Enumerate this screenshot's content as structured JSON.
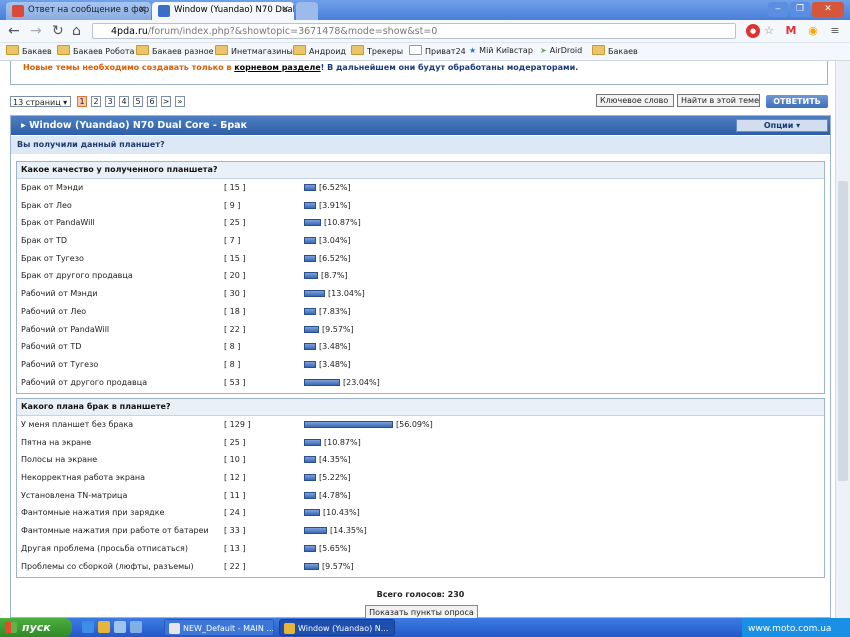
{
  "browser": {
    "tabs": [
      {
        "label": "Ответ на сообщение в фор"
      },
      {
        "label": "Window (Yuandao) N70 Dual"
      }
    ],
    "url_host": "4pda.ru",
    "url_rest": "/forum/index.php?&showtopic=3671478&mode=show&st=0",
    "bookmarks": [
      "Бакаев",
      "Бакаев Робота",
      "Бакаев разное",
      "Инетмагазины",
      "Андроид",
      "Трекеры",
      "Приват24",
      "Мій Київстар",
      "AirDroid",
      "Бакаев"
    ]
  },
  "notice": {
    "part1": "Новые темы необходимо создавать только в",
    "link": "корневом разделе",
    "part2": "! В дальнейшем они будут обработаны модераторами."
  },
  "pager": {
    "select": "13 страниц",
    "pages": [
      "1",
      "2",
      "3",
      "4",
      "5",
      "6",
      ">",
      "»"
    ],
    "current": "1"
  },
  "top_buttons": {
    "keyword": "Ключевое слово",
    "find_in_topic": "Найти в этой теме",
    "reply": "ОТВЕТИТЬ"
  },
  "topic": {
    "title": "Window (Yuandao) N70 Dual Core - Брак",
    "options": "Опции ▾",
    "poll_question": "Вы получили данный планшет?"
  },
  "polls": [
    {
      "title": "Какое качество у полученного планшета?",
      "rows": [
        {
          "label": "Брак от Мэнди",
          "count": "[ 15 ]",
          "pct": "[6.52%]",
          "value": 6.52
        },
        {
          "label": "Брак от Лео",
          "count": "[ 9 ]",
          "pct": "[3.91%]",
          "value": 3.91
        },
        {
          "label": "Брак от PandaWill",
          "count": "[ 25 ]",
          "pct": "[10.87%]",
          "value": 10.87
        },
        {
          "label": "Брак от TD",
          "count": "[ 7 ]",
          "pct": "[3.04%]",
          "value": 3.04
        },
        {
          "label": "Брак от Тугезо",
          "count": "[ 15 ]",
          "pct": "[6.52%]",
          "value": 6.52
        },
        {
          "label": "Брак от другого продавца",
          "count": "[ 20 ]",
          "pct": "[8.7%]",
          "value": 8.7
        },
        {
          "label": "Рабочий от Мэнди",
          "count": "[ 30 ]",
          "pct": "[13.04%]",
          "value": 13.04
        },
        {
          "label": "Рабочий от Лео",
          "count": "[ 18 ]",
          "pct": "[7.83%]",
          "value": 7.83
        },
        {
          "label": "Рабочий от PandaWill",
          "count": "[ 22 ]",
          "pct": "[9.57%]",
          "value": 9.57
        },
        {
          "label": "Рабочий от TD",
          "count": "[ 8 ]",
          "pct": "[3.48%]",
          "value": 3.48
        },
        {
          "label": "Рабочий от Тугезо",
          "count": "[ 8 ]",
          "pct": "[3.48%]",
          "value": 3.48
        },
        {
          "label": "Рабочий от другого продавца",
          "count": "[ 53 ]",
          "pct": "[23.04%]",
          "value": 23.04
        }
      ]
    },
    {
      "title": "Какого плана брак в планшете?",
      "rows": [
        {
          "label": "У меня планшет без брака",
          "count": "[ 129 ]",
          "pct": "[56.09%]",
          "value": 56.09
        },
        {
          "label": "Пятна на экране",
          "count": "[ 25 ]",
          "pct": "[10.87%]",
          "value": 10.87
        },
        {
          "label": "Полосы на экране",
          "count": "[ 10 ]",
          "pct": "[4.35%]",
          "value": 4.35
        },
        {
          "label": "Некорректная работа экрана",
          "count": "[ 12 ]",
          "pct": "[5.22%]",
          "value": 5.22
        },
        {
          "label": "Установлена TN-матрица",
          "count": "[ 11 ]",
          "pct": "[4.78%]",
          "value": 4.78
        },
        {
          "label": "Фантомные нажатия при зарядке",
          "count": "[ 24 ]",
          "pct": "[10.43%]",
          "value": 10.43
        },
        {
          "label": "Фантомные нажатия при работе от батареи",
          "count": "[ 33 ]",
          "pct": "[14.35%]",
          "value": 14.35
        },
        {
          "label": "Другая проблема (просьба отписаться)",
          "count": "[ 13 ]",
          "pct": "[5.65%]",
          "value": 5.65
        },
        {
          "label": "Проблемы со сборкой (люфты, разъемы)",
          "count": "[ 22 ]",
          "pct": "[9.57%]",
          "value": 9.57
        }
      ]
    }
  ],
  "total_votes": "Всего голосов: 230",
  "show_results": "Показать пункты опроса",
  "taskbar": {
    "start": "пуск",
    "tasks": [
      "NEW_Default - MAIN ...",
      "Window (Yuandao) N..."
    ]
  },
  "watermark": "www.moto.com.ua"
}
